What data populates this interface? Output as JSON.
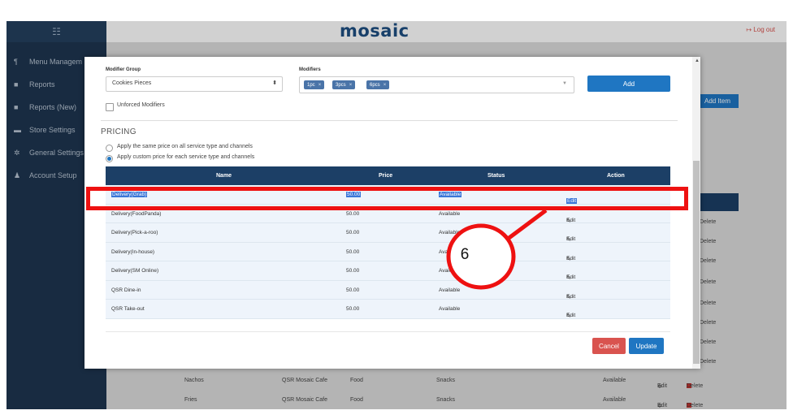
{
  "app": {
    "brand": "mosaic",
    "logout": "Log out"
  },
  "sidebar": {
    "menu_icon": "list-icon",
    "items": [
      {
        "icon": "utensils-icon",
        "glyph": "¶",
        "label": "Menu Managem"
      },
      {
        "icon": "document-icon",
        "glyph": "■",
        "label": "Reports"
      },
      {
        "icon": "document-icon",
        "glyph": "■",
        "label": "Reports (New)"
      },
      {
        "icon": "store-icon",
        "glyph": "▬",
        "label": "Store Settings"
      },
      {
        "icon": "gear-icon",
        "glyph": "✲",
        "label": "General Settings"
      },
      {
        "icon": "user-icon",
        "glyph": "♟",
        "label": "Account Setup"
      }
    ]
  },
  "background": {
    "add_item": "Add Item",
    "delete_label": "Delete",
    "rows": [
      {
        "name": "Nachos",
        "store": "QSR Mosaic Cafe",
        "type": "Food",
        "category": "Snacks",
        "status": "Available",
        "edit": "Edit",
        "delete": "Delete"
      },
      {
        "name": "Fries",
        "store": "QSR Mosaic Cafe",
        "type": "Food",
        "category": "Snacks",
        "status": "Available",
        "edit": "Edit",
        "delete": "Delete"
      }
    ]
  },
  "modal": {
    "modifier_group_label": "Modifier Group",
    "modifier_group_value": "Cookies Pieces",
    "modifiers_label": "Modifiers",
    "modifiers": [
      "1pc",
      "3pcs",
      "6pcs"
    ],
    "add_button": "Add",
    "unforced_label": "Unforced Modifiers",
    "pricing_title": "PRICING",
    "radio_same": "Apply the same price on all service type and channels",
    "radio_custom": "Apply custom price for each service type and channels",
    "table": {
      "headers": {
        "name": "Name",
        "price": "Price",
        "status": "Status",
        "action": "Action"
      },
      "rows": [
        {
          "name": "Delivery(Grab)",
          "price": "50.00",
          "status": "Available",
          "action": "Edit"
        },
        {
          "name": "Delivery(FoodPanda)",
          "price": "50.00",
          "status": "Available",
          "action": "Edit"
        },
        {
          "name": "Delivery(Pick-a-roo)",
          "price": "50.00",
          "status": "Available",
          "action": "Edit"
        },
        {
          "name": "Delivery(In-house)",
          "price": "50.00",
          "status": "Available",
          "action": "Edit"
        },
        {
          "name": "Delivery(SM Online)",
          "price": "50.00",
          "status": "Available",
          "action": "Edit"
        },
        {
          "name": "QSR Dine-in",
          "price": "50.00",
          "status": "Available",
          "action": "Edit"
        },
        {
          "name": "QSR Take-out",
          "price": "50.00",
          "status": "Available",
          "action": "Edit"
        }
      ]
    },
    "cancel_button": "Cancel",
    "update_button": "Update"
  },
  "annotation": {
    "callout_number": "6",
    "color": "#ee1111"
  }
}
